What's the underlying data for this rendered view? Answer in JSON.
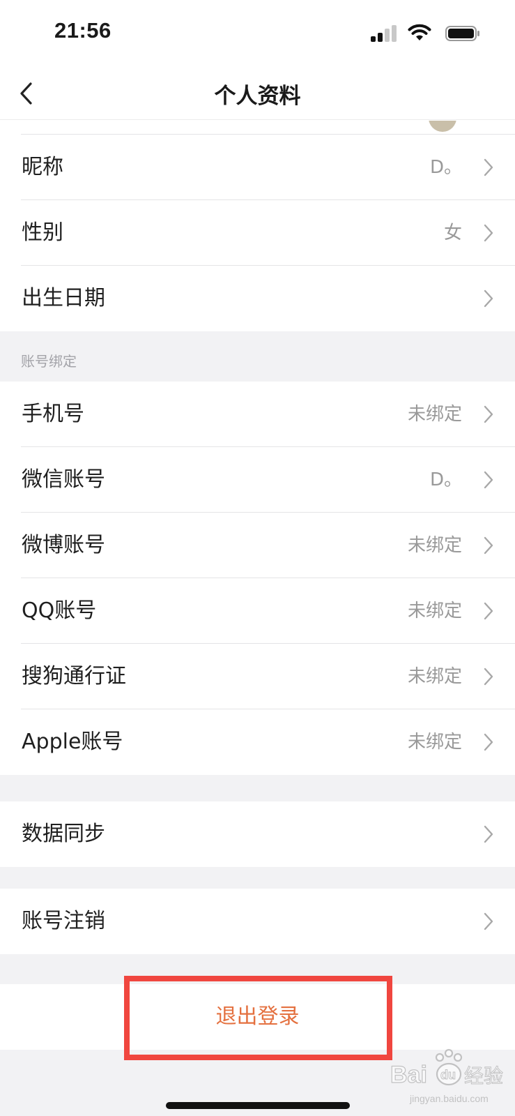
{
  "status_bar": {
    "time": "21:56",
    "icons": [
      "signal-icon",
      "wifi-icon",
      "battery-icon"
    ]
  },
  "nav": {
    "title": "个人资料",
    "back_icon": "chevron-left-icon"
  },
  "profile_rows": [
    {
      "label": "昵称",
      "value": "D。"
    },
    {
      "label": "性别",
      "value": "女"
    },
    {
      "label": "出生日期",
      "value": ""
    }
  ],
  "binding_section": {
    "header": "账号绑定",
    "rows": [
      {
        "label": "手机号",
        "value": "未绑定"
      },
      {
        "label": "微信账号",
        "value": "D。"
      },
      {
        "label": "微博账号",
        "value": "未绑定"
      },
      {
        "label": "QQ账号",
        "value": "未绑定"
      },
      {
        "label": "搜狗通行证",
        "value": "未绑定"
      },
      {
        "label": "Apple账号",
        "value": "未绑定"
      }
    ]
  },
  "sync_row": {
    "label": "数据同步"
  },
  "cancel_row": {
    "label": "账号注销"
  },
  "logout": {
    "label": "退出登录"
  },
  "watermark": {
    "text": "Baidu 经验",
    "subtext": "jingyan.baidu.com"
  },
  "colors": {
    "accent": "#e4703f",
    "highlight": "#f0463f",
    "background": "#f2f2f4",
    "value_text": "#999999"
  }
}
